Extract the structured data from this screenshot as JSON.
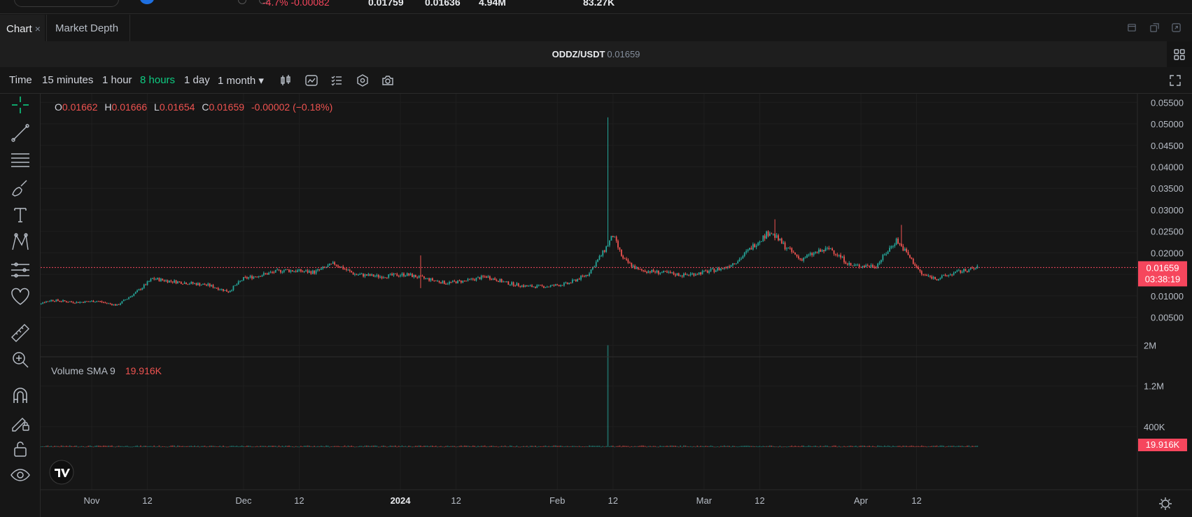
{
  "ticker": {
    "change": "-4.7%  -0.00082",
    "high": "0.01759",
    "low": "0.01636",
    "volume_base": "4.94M",
    "volume_quote": "83.27K"
  },
  "tabs": [
    {
      "label": "Chart",
      "close": "×"
    },
    {
      "label": "Market Depth"
    }
  ],
  "symbol_bar": {
    "symbol": "ODDZ/USDT",
    "last_price": "0.01659"
  },
  "intervals": {
    "time_label": "Time",
    "items": [
      "15 minutes",
      "1 hour",
      "8 hours",
      "1 day",
      "1 month ▾"
    ],
    "active": "8 hours"
  },
  "left_tools": [
    "crosshair-icon",
    "trend-line-icon",
    "fib-lines-icon",
    "brush-icon",
    "text-icon",
    "pattern-icon",
    "prediction-icon",
    "favorite-heart-icon",
    "ruler-icon",
    "zoom-in-icon",
    "magnet-icon",
    "lock-drawing-icon",
    "lock-icon",
    "eye-icon"
  ],
  "colors": {
    "up": "#26a69a",
    "down": "#ef5350",
    "active": "#0ecb81",
    "background": "#161616"
  },
  "chart_data": {
    "type": "candlestick",
    "ohlc_legend": {
      "o": "0.01662",
      "h": "0.01666",
      "l": "0.01654",
      "c": "0.01659",
      "change": "-0.00002 (−0.18%)"
    },
    "price_axis": {
      "ticks": [
        "0.05500",
        "0.05000",
        "0.04500",
        "0.04000",
        "0.03500",
        "0.03000",
        "0.02500",
        "0.02000",
        "0.01500",
        "0.01000",
        "0.00500"
      ],
      "range": [
        0.0025,
        0.057
      ]
    },
    "current_price": {
      "value": 0.01659,
      "label": "0.01659",
      "countdown": "03:38:19"
    },
    "x_axis_labels": [
      {
        "text": "Nov",
        "bold": false
      },
      {
        "text": "12",
        "bold": false
      },
      {
        "text": "Dec",
        "bold": false
      },
      {
        "text": "12",
        "bold": false
      },
      {
        "text": "2024",
        "bold": true
      },
      {
        "text": "12",
        "bold": false
      },
      {
        "text": "Feb",
        "bold": false
      },
      {
        "text": "12",
        "bold": false
      },
      {
        "text": "Mar",
        "bold": false
      },
      {
        "text": "12",
        "bold": false
      },
      {
        "text": "Apr",
        "bold": false
      },
      {
        "text": "12",
        "bold": false
      }
    ],
    "price_series_anchors": [
      {
        "date": "2023-10-20",
        "close": 0.0078
      },
      {
        "date": "2023-10-24",
        "close": 0.009
      },
      {
        "date": "2023-10-29",
        "close": 0.0085
      },
      {
        "date": "2023-11-02",
        "close": 0.0088
      },
      {
        "date": "2023-11-06",
        "close": 0.0078
      },
      {
        "date": "2023-11-10",
        "close": 0.011
      },
      {
        "date": "2023-11-13",
        "close": 0.014
      },
      {
        "date": "2023-11-16",
        "close": 0.0135
      },
      {
        "date": "2023-11-20",
        "close": 0.013
      },
      {
        "date": "2023-11-24",
        "close": 0.0125
      },
      {
        "date": "2023-11-28",
        "close": 0.011
      },
      {
        "date": "2023-12-01",
        "close": 0.014
      },
      {
        "date": "2023-12-05",
        "close": 0.015
      },
      {
        "date": "2023-12-09",
        "close": 0.016
      },
      {
        "date": "2023-12-15",
        "close": 0.0155
      },
      {
        "date": "2023-12-19",
        "close": 0.0175
      },
      {
        "date": "2023-12-23",
        "close": 0.015
      },
      {
        "date": "2023-12-28",
        "close": 0.0145
      },
      {
        "date": "2024-01-02",
        "close": 0.015
      },
      {
        "date": "2024-01-06",
        "close": 0.014
      },
      {
        "date": "2024-01-10",
        "close": 0.013
      },
      {
        "date": "2024-01-14",
        "close": 0.0135
      },
      {
        "date": "2024-01-18",
        "close": 0.0145
      },
      {
        "date": "2024-01-22",
        "close": 0.013
      },
      {
        "date": "2024-01-26",
        "close": 0.0122
      },
      {
        "date": "2024-01-30",
        "close": 0.0122
      },
      {
        "date": "2024-02-03",
        "close": 0.0128
      },
      {
        "date": "2024-02-07",
        "close": 0.015
      },
      {
        "date": "2024-02-10",
        "close": 0.02
      },
      {
        "date": "2024-02-12",
        "close": 0.024
      },
      {
        "date": "2024-02-14",
        "close": 0.0185
      },
      {
        "date": "2024-02-17",
        "close": 0.016
      },
      {
        "date": "2024-02-21",
        "close": 0.0155
      },
      {
        "date": "2024-02-26",
        "close": 0.0148
      },
      {
        "date": "2024-03-01",
        "close": 0.0155
      },
      {
        "date": "2024-03-05",
        "close": 0.0165
      },
      {
        "date": "2024-03-08",
        "close": 0.0185
      },
      {
        "date": "2024-03-11",
        "close": 0.022
      },
      {
        "date": "2024-03-14",
        "close": 0.025
      },
      {
        "date": "2024-03-17",
        "close": 0.0215
      },
      {
        "date": "2024-03-20",
        "close": 0.0185
      },
      {
        "date": "2024-03-23",
        "close": 0.02
      },
      {
        "date": "2024-03-26",
        "close": 0.021
      },
      {
        "date": "2024-03-30",
        "close": 0.017
      },
      {
        "date": "2024-04-04",
        "close": 0.017
      },
      {
        "date": "2024-04-08",
        "close": 0.023
      },
      {
        "date": "2024-04-10",
        "close": 0.02
      },
      {
        "date": "2024-04-13",
        "close": 0.015
      },
      {
        "date": "2024-04-16",
        "close": 0.014
      },
      {
        "date": "2024-04-20",
        "close": 0.0155
      },
      {
        "date": "2024-04-24",
        "close": 0.0165
      }
    ],
    "spikes": [
      {
        "date": "2024-02-11",
        "high": 0.0515
      },
      {
        "date": "2024-03-15",
        "high": 0.0278
      },
      {
        "date": "2024-04-09",
        "high": 0.0265
      },
      {
        "date": "2024-01-05",
        "high": 0.0194,
        "low": 0.0118
      }
    ],
    "volume": {
      "label": "Volume SMA 9",
      "sma_value": "19.916K",
      "axis_ticks": [
        "2M",
        "1.2M",
        "400K"
      ],
      "range": [
        0,
        2200000
      ],
      "spike": {
        "date": "2024-02-11",
        "value": 2000000
      },
      "typical_value": 20000
    }
  }
}
